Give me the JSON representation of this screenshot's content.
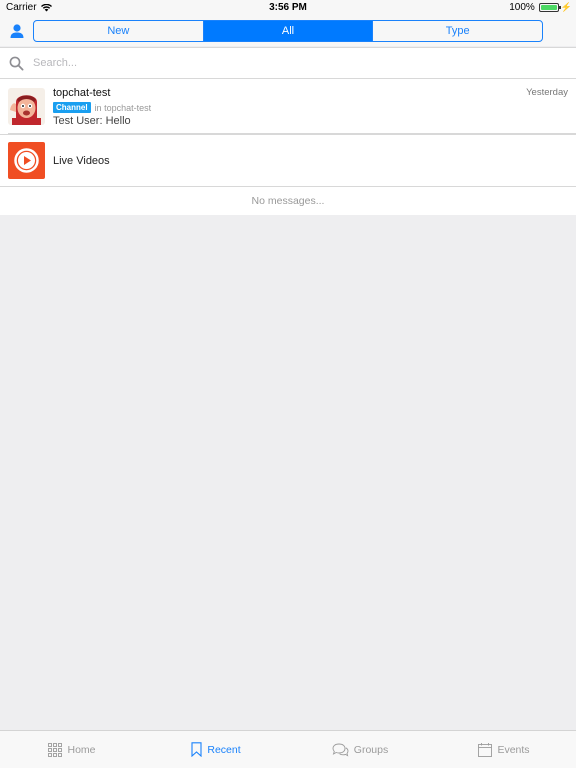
{
  "status_bar": {
    "carrier": "Carrier",
    "time": "3:56 PM",
    "battery": "100%"
  },
  "nav": {
    "segments": [
      {
        "label": "New",
        "active": false
      },
      {
        "label": "All",
        "active": true
      },
      {
        "label": "Type",
        "active": false
      }
    ]
  },
  "search": {
    "placeholder": "Search..."
  },
  "list": {
    "items": [
      {
        "title": "topchat-test",
        "time": "Yesterday",
        "badge": "Channel",
        "context": "in topchat-test",
        "last_message": "Test User: Hello"
      },
      {
        "title": "Live Videos"
      }
    ],
    "empty_text": "No messages..."
  },
  "tab_bar": {
    "tabs": [
      {
        "label": "Home",
        "icon": "grid-icon",
        "active": false
      },
      {
        "label": "Recent",
        "icon": "bookmark-icon",
        "active": true
      },
      {
        "label": "Groups",
        "icon": "chat-bubbles-icon",
        "active": false
      },
      {
        "label": "Events",
        "icon": "calendar-icon",
        "active": false
      }
    ]
  },
  "colors": {
    "accent": "#007aff",
    "badge": "#1a9ff0",
    "video_icon": "#f04e23",
    "battery": "#4cd964"
  }
}
